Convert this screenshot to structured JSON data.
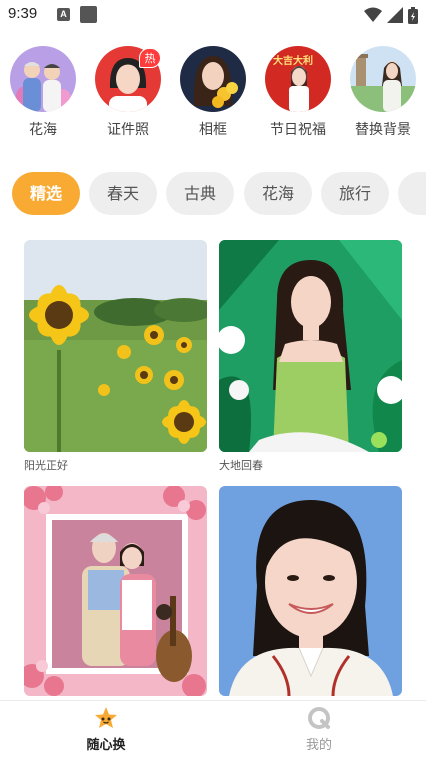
{
  "status_bar": {
    "time": "9:39",
    "notification_letter": "A"
  },
  "categories": [
    {
      "label": "花海"
    },
    {
      "label": "证件照",
      "badge": "热"
    },
    {
      "label": "相框"
    },
    {
      "label": "节日祝福",
      "poster_text": "大吉大利"
    },
    {
      "label": "替换背景"
    }
  ],
  "tabs": [
    {
      "label": "精选",
      "active": true
    },
    {
      "label": "春天",
      "active": false
    },
    {
      "label": "古典",
      "active": false
    },
    {
      "label": "花海",
      "active": false
    },
    {
      "label": "旅行",
      "active": false
    }
  ],
  "cards": [
    {
      "caption": "阳光正好"
    },
    {
      "caption": "大地回春"
    },
    {
      "caption": ""
    },
    {
      "caption": ""
    }
  ],
  "bottom_nav": [
    {
      "label": "随心换",
      "icon": "star-icon",
      "active": true
    },
    {
      "label": "我的",
      "icon": "profile-q-icon",
      "active": false
    }
  ],
  "colors": {
    "accent": "#f9aa33",
    "hot_badge": "#ff3b3b"
  }
}
